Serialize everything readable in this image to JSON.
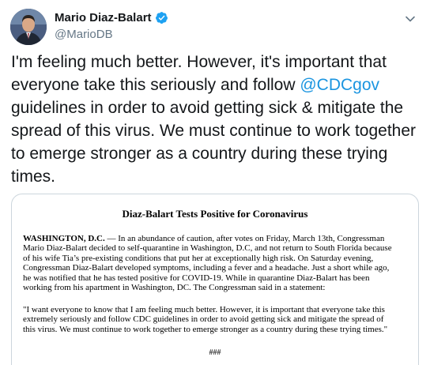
{
  "author": {
    "display_name": "Mario Diaz-Balart",
    "handle": "@MarioDB",
    "verified": true,
    "avatar_icon": "profile-photo"
  },
  "tweet": {
    "lines": [
      {
        "pre": "I'm feeling much better.  However, it's important that",
        "mention": "",
        "post": ""
      },
      {
        "pre": "everyone take this seriously and follow ",
        "mention": "@CDCgov",
        "post": ""
      },
      {
        "pre": " guidelines in order to avoid getting sick & mitigate the",
        "mention": "",
        "post": ""
      },
      {
        "pre": "spread of this virus. We must continue to work together",
        "mention": "",
        "post": ""
      },
      {
        "pre": "to emerge stronger as a country during these trying",
        "mention": "",
        "post": ""
      },
      {
        "pre": "times.",
        "mention": "",
        "post": ""
      }
    ]
  },
  "press_release": {
    "title": "Diaz-Balart Tests Positive for Coronavirus",
    "dateline": "WASHINGTON, D.C.",
    "body_lines": [
      " — In an abundance of caution, after votes on Friday, March 13th, Congressman",
      "Mario Diaz-Balart decided to self-quarantine in Washington, D.C, and not return to South Florida because",
      "of his wife Tia’s pre-existing conditions that put her at exceptionally high risk.  On Saturday evening,",
      "Congressman Diaz-Balart developed symptoms, including a fever and a headache.  Just a short while ago,",
      "he was notified that he has tested positive for COVID-19. While in quarantine Diaz-Balart has been",
      "working from his apartment in Washington, DC. The Congressman said in a statement:"
    ],
    "quote_lines": [
      "\"I want everyone to know that I am feeling much better.  However, it is important that everyone take this",
      "extremely seriously and follow CDC guidelines in order to avoid getting sick and mitigate the spread of",
      "this virus.  We must continue to work together to emerge stronger as a country during these trying times.\""
    ],
    "end_mark": "###"
  },
  "colors": {
    "link": "#1b95e0",
    "verified_badge": "#1da1f2",
    "secondary_text": "#657786",
    "border": "#ccd6dd"
  }
}
